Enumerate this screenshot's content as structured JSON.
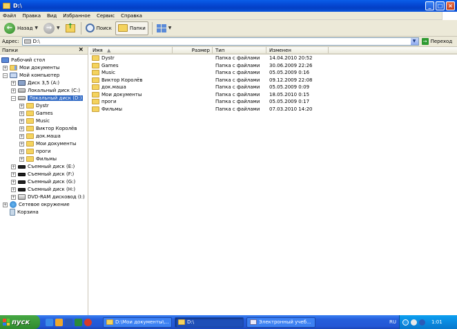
{
  "window": {
    "title": "D:\\"
  },
  "menu": [
    "Файл",
    "Правка",
    "Вид",
    "Избранное",
    "Сервис",
    "Справка"
  ],
  "toolbar": {
    "back": "Назад",
    "search": "Поиск",
    "folders": "Папки"
  },
  "address": {
    "label": "Адрес:",
    "value": "D:\\",
    "go": "Переход"
  },
  "folders_pane": {
    "title": "Папки",
    "close": "×",
    "tree": [
      {
        "label": "Рабочий стол",
        "icon": "desktop-icon"
      },
      {
        "label": "Мои документы",
        "icon": "my-documents-icon"
      },
      {
        "label": "Мой компьютер",
        "icon": "my-computer-icon"
      },
      {
        "label": "Диск 3,5 (A:)",
        "icon": "floppy-drive-icon"
      },
      {
        "label": "Локальный диск (C:)",
        "icon": "hard-drive-icon"
      },
      {
        "label": "Локальный диск (D:)",
        "icon": "hard-drive-icon"
      },
      {
        "label": "Dystr",
        "icon": "folder-icon"
      },
      {
        "label": "Games",
        "icon": "folder-icon"
      },
      {
        "label": "Music",
        "icon": "folder-icon"
      },
      {
        "label": "Виктор Королёв",
        "icon": "folder-icon"
      },
      {
        "label": "док.маша",
        "icon": "folder-icon"
      },
      {
        "label": "Мои документы",
        "icon": "folder-icon"
      },
      {
        "label": "проги",
        "icon": "folder-icon"
      },
      {
        "label": "Фильмы",
        "icon": "folder-icon"
      },
      {
        "label": "Съемный диск (E:)",
        "icon": "removable-drive-icon"
      },
      {
        "label": "Съемный диск (F:)",
        "icon": "removable-drive-icon"
      },
      {
        "label": "Съемный диск (G:)",
        "icon": "removable-drive-icon"
      },
      {
        "label": "Съемный диск (H:)",
        "icon": "removable-drive-icon"
      },
      {
        "label": "DVD-RAM дисковод (I:)",
        "icon": "dvd-drive-icon"
      },
      {
        "label": "Сетевое окружение",
        "icon": "network-icon"
      },
      {
        "label": "Корзина",
        "icon": "recycle-bin-icon"
      }
    ]
  },
  "file_list": {
    "columns": [
      "Имя",
      "Размер",
      "Тип",
      "Изменен"
    ],
    "rows": [
      {
        "name": "Dystr",
        "size": "",
        "type": "Папка с файлами",
        "modified": "14.04.2010 20:52"
      },
      {
        "name": "Games",
        "size": "",
        "type": "Папка с файлами",
        "modified": "30.06.2009 22:26"
      },
      {
        "name": "Music",
        "size": "",
        "type": "Папка с файлами",
        "modified": "05.05.2009 0:16"
      },
      {
        "name": "Виктор Королёв",
        "size": "",
        "type": "Папка с файлами",
        "modified": "09.12.2009 22:08"
      },
      {
        "name": "док.маша",
        "size": "",
        "type": "Папка с файлами",
        "modified": "05.05.2009 0:09"
      },
      {
        "name": "Мои документы",
        "size": "",
        "type": "Папка с файлами",
        "modified": "18.05.2010 0:15"
      },
      {
        "name": "проги",
        "size": "",
        "type": "Папка с файлами",
        "modified": "05.05.2009 0:17"
      },
      {
        "name": "Фильмы",
        "size": "",
        "type": "Папка с файлами",
        "modified": "07.03.2010 14:20"
      }
    ]
  },
  "taskbar": {
    "start": "пуск",
    "tasks": [
      "D:\\Мои документы\\...",
      "D:\\",
      "Электронный учеб..."
    ],
    "lang": "RU",
    "clock": "1:01"
  },
  "colors": {
    "selection": "#316ac5",
    "titlebar": "#0a5ee8",
    "taskbar": "#245edb",
    "start": "#3c9a3a"
  }
}
